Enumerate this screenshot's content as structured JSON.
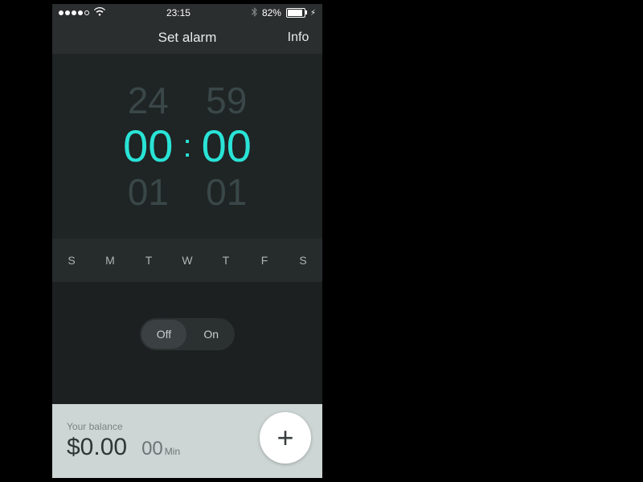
{
  "status": {
    "time": "23:15",
    "battery_pct": "82%",
    "bluetooth_icon": "bluetooth",
    "wifi_icon": "wifi",
    "signal_dots_filled": 4,
    "signal_dots_total": 5
  },
  "nav": {
    "title": "Set alarm",
    "info": "Info"
  },
  "picker": {
    "hour_prev": "24",
    "hour_sel": "00",
    "hour_next": "01",
    "min_prev": "59",
    "min_sel": "00",
    "min_next": "01",
    "separator": ":"
  },
  "days": [
    "S",
    "M",
    "T",
    "W",
    "T",
    "F",
    "S"
  ],
  "toggle": {
    "off": "Off",
    "on": "On",
    "state": "off"
  },
  "footer": {
    "label": "Your balance",
    "amount": "$0.00",
    "minutes": "00",
    "minutes_unit": "Min",
    "add_icon": "+"
  },
  "colors": {
    "accent": "#29e3d6",
    "bg_dark": "#1c2021",
    "panel": "#262b2c",
    "footer_bg": "#cdd6d4"
  }
}
